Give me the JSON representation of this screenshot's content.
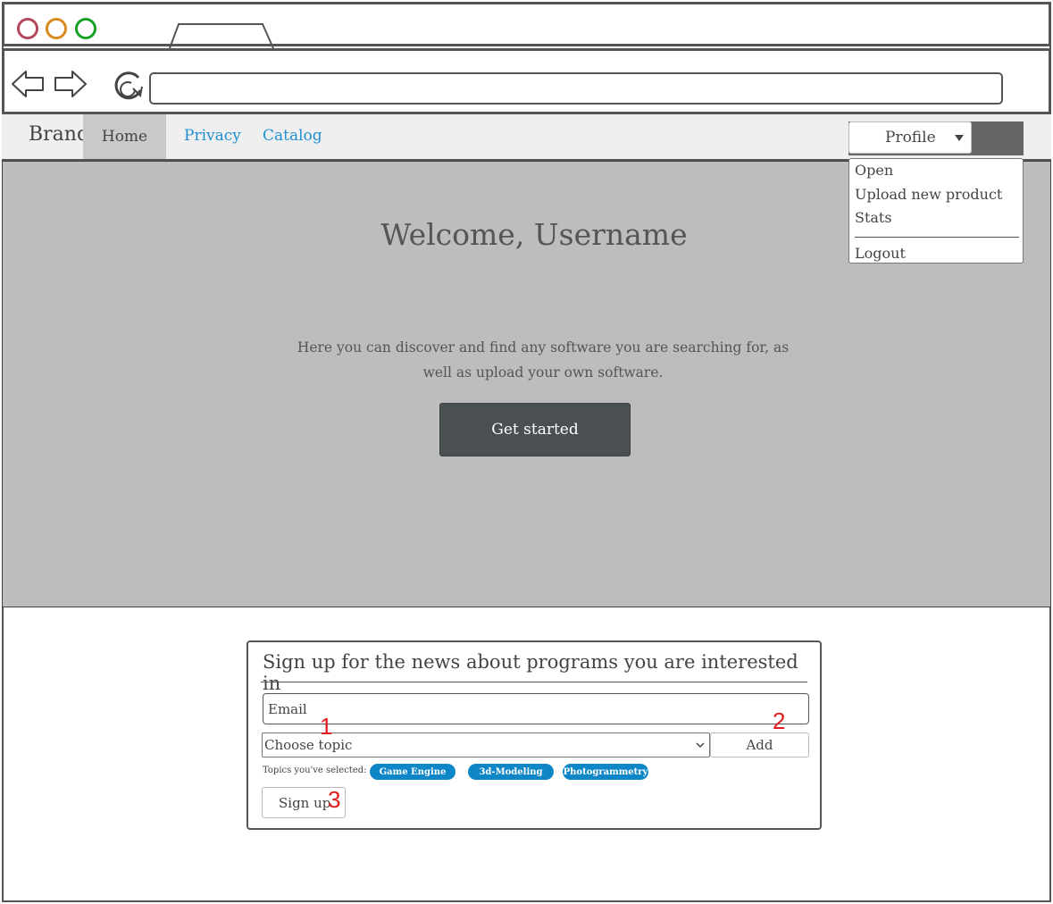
{
  "site": {
    "brand": "Brand",
    "nav": {
      "home": "Home",
      "privacy": "Privacy",
      "catalog": "Catalog"
    },
    "profile": {
      "label": "Profile"
    },
    "menu": {
      "open": "Open",
      "upload": "Upload new product",
      "stats": "Stats",
      "logout": "Logout"
    }
  },
  "hero": {
    "title": "Welcome, Username",
    "text": "Here you can discover and find any software you are searching for, as well as upload your own software.",
    "button": "Get started"
  },
  "signup": {
    "title": "Sign up for the news about programs you are interested in",
    "email_placeholder": "Email",
    "topic_placeholder": "Choose topic",
    "add_label": "Add",
    "selected_label": "Topics you've selected:",
    "topics": [
      "Game Engine",
      "3d-Modeling",
      "Photogrammetry"
    ],
    "signup_label": "Sign up"
  },
  "annotations": [
    "1",
    "2",
    "3"
  ],
  "colors": {
    "link": "#1f8fd0",
    "chip": "#0f86c8",
    "hero_bg": "#bdbdbd",
    "button_dark": "#4a4f52",
    "annotation": "#e01b1b"
  }
}
